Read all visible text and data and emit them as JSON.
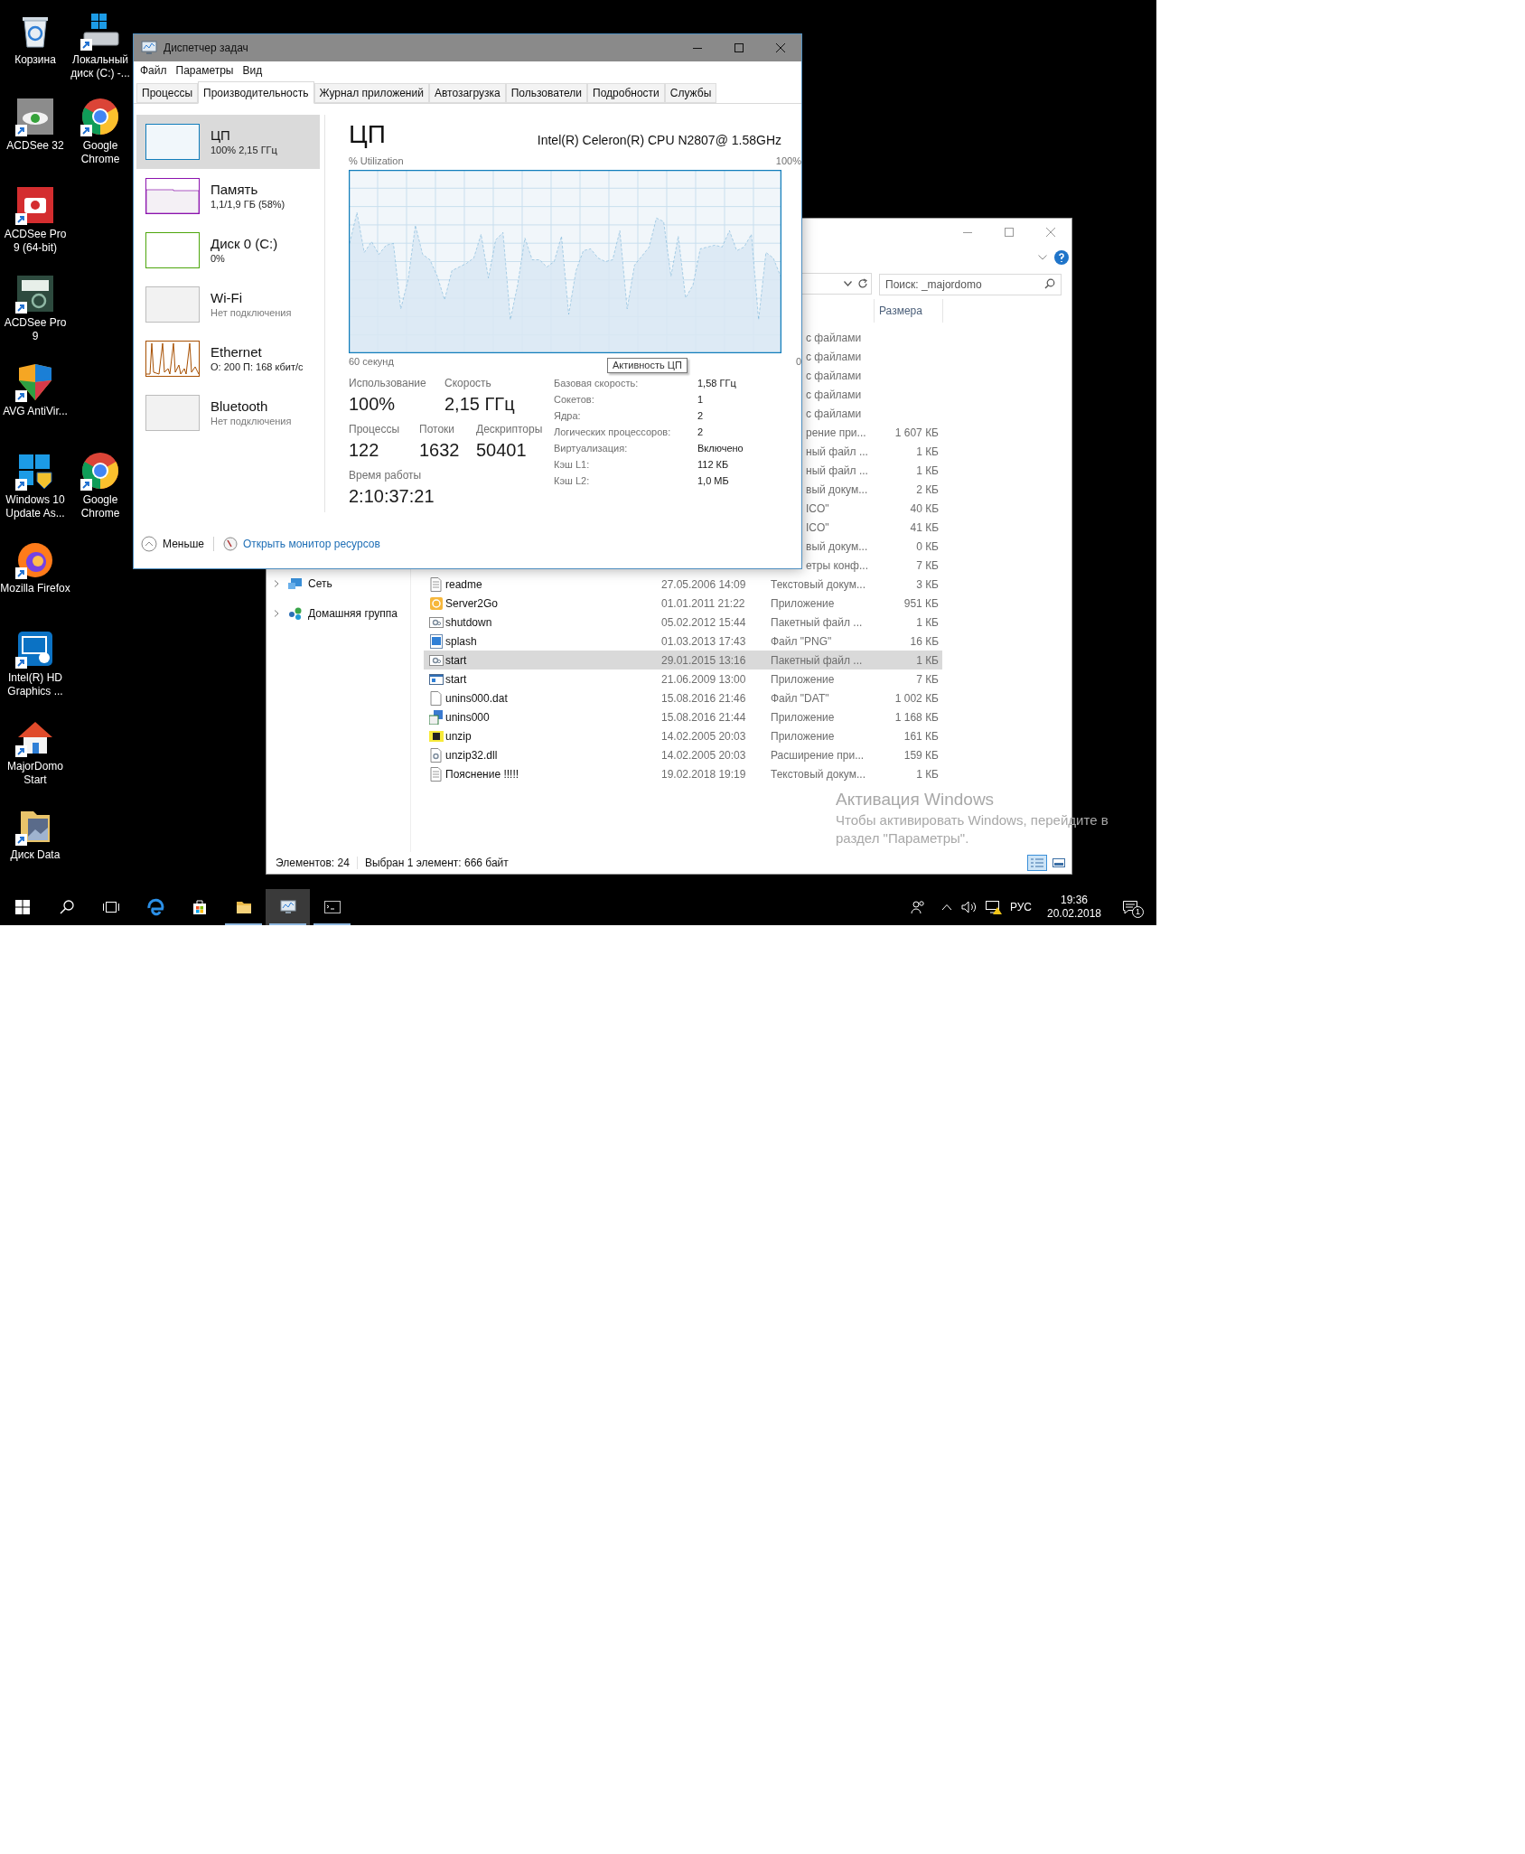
{
  "desktop": {
    "icons": [
      {
        "label": "Корзина"
      },
      {
        "label": "Локальный диск (C:) -..."
      },
      {
        "label": "ACDSee 32"
      },
      {
        "label": "Google Chrome"
      },
      {
        "label": "ACDSee Pro 9 (64-bit)"
      },
      {
        "label": "ACDSee Pro 9"
      },
      {
        "label": "AVG AntiVir..."
      },
      {
        "label": "Windows 10 Update As..."
      },
      {
        "label": "Google Chrome"
      },
      {
        "label": "Mozilla Firefox"
      },
      {
        "label": "Intel(R) HD Graphics ..."
      },
      {
        "label": "MajorDomo Start"
      },
      {
        "label": "Диск Data"
      }
    ]
  },
  "task_manager": {
    "title": "Диспетчер задач",
    "menu": [
      "Файл",
      "Параметры",
      "Вид"
    ],
    "tabs": [
      {
        "label": "Процессы",
        "selected": false
      },
      {
        "label": "Производительность",
        "selected": true
      },
      {
        "label": "Журнал приложений",
        "selected": false
      },
      {
        "label": "Автозагрузка",
        "selected": false
      },
      {
        "label": "Пользователи",
        "selected": false
      },
      {
        "label": "Подробности",
        "selected": false
      },
      {
        "label": "Службы",
        "selected": false
      }
    ],
    "sidebar": [
      {
        "title": "ЦП",
        "subtitle": "100% 2,15 ГГц",
        "kind": "blank",
        "color": "#117dbb",
        "dimmed": false,
        "selected": true
      },
      {
        "title": "Память",
        "subtitle": "1,1/1,9 ГБ (58%)",
        "kind": "fill",
        "color": "#8b12ae",
        "dimmed": false,
        "selected": false
      },
      {
        "title": "Диск 0 (C:)",
        "subtitle": "0%",
        "kind": "blank",
        "color": "#4da60c",
        "dimmed": false,
        "selected": false
      },
      {
        "title": "Wi-Fi",
        "subtitle": "Нет подключения",
        "kind": "blank",
        "color": "#bcbcbc",
        "dimmed": true,
        "selected": false
      },
      {
        "title": "Ethernet",
        "subtitle": "О: 200 П: 168 кбит/с",
        "kind": "spikes",
        "color": "#a74f01",
        "dimmed": false,
        "selected": false
      },
      {
        "title": "Bluetooth",
        "subtitle": "Нет подключения",
        "kind": "blank",
        "color": "#bcbcbc",
        "dimmed": true,
        "selected": false
      }
    ],
    "panel": {
      "title": "ЦП",
      "cpu_name": "Intel(R) Celeron(R) CPU N2807@ 1.58GHz",
      "graph": {
        "label": "% Utilization",
        "max_label": "100%",
        "span_label": "60 секунд",
        "end_label": "0"
      },
      "tooltip": "Активность ЦП",
      "stats": [
        {
          "label": "Использование",
          "value": "100%"
        },
        {
          "label": "Скорость",
          "value": "2,15 ГГц"
        },
        {
          "label": "Процессы",
          "value": "122"
        },
        {
          "label": "Потоки",
          "value": "1632"
        },
        {
          "label": "Дескрипторы",
          "value": "50401"
        },
        {
          "label": "Время работы",
          "value": "2:10:37:21"
        }
      ],
      "details": [
        {
          "label": "Базовая скорость:",
          "value": "1,58 ГГц"
        },
        {
          "label": "Сокетов:",
          "value": "1"
        },
        {
          "label": "Ядра:",
          "value": "2"
        },
        {
          "label": "Логических процессоров:",
          "value": "2"
        },
        {
          "label": "Виртуализация:",
          "value": "Включено"
        },
        {
          "label": "Кэш L1:",
          "value": "112 КБ"
        },
        {
          "label": "Кэш L2:",
          "value": "1,0 МБ"
        }
      ]
    },
    "footer": {
      "less": "Меньше",
      "link": "Открыть монитор ресурсов"
    }
  },
  "explorer": {
    "search_placeholder": "Поиск: _majordomo",
    "size_column": "Размера",
    "nav": [
      {
        "label": "Сеть",
        "expanded": false
      },
      {
        "label": "Домашняя группа",
        "expanded": false
      }
    ],
    "rows": [
      {
        "type": "с файлами",
        "selected": false
      },
      {
        "type": "с файлами",
        "selected": false
      },
      {
        "type": "с файлами",
        "selected": false
      },
      {
        "type": "с файлами",
        "selected": false
      },
      {
        "type": "с файлами",
        "selected": false
      },
      {
        "type": "рение при...",
        "size": "1 607 КБ",
        "selected": false
      },
      {
        "type": "ный файл ...",
        "size": "1 КБ",
        "selected": false
      },
      {
        "type": "ный файл ...",
        "size": "1 КБ",
        "selected": false
      },
      {
        "type": "вый докум...",
        "size": "2 КБ",
        "selected": false
      },
      {
        "type": "ICO\"",
        "size": "40 КБ",
        "selected": false
      },
      {
        "type": "ICO\"",
        "size": "41 КБ",
        "selected": false
      },
      {
        "type": "вый докум...",
        "size": "0 КБ",
        "selected": false
      },
      {
        "type": "етры конф...",
        "size": "7 КБ",
        "selected": false
      },
      {
        "name": "readme",
        "date": "27.05.2006 14:09",
        "type": "Текстовый докум...",
        "size": "3 КБ",
        "selected": false
      },
      {
        "name": "Server2Go",
        "date": "01.01.2011 21:22",
        "type": "Приложение",
        "size": "951 КБ",
        "selected": false
      },
      {
        "name": "shutdown",
        "date": "05.02.2012 15:44",
        "type": "Пакетный файл ...",
        "size": "1 КБ",
        "selected": false
      },
      {
        "name": "splash",
        "date": "01.03.2013 17:43",
        "type": "Файл \"PNG\"",
        "size": "16 КБ",
        "selected": false
      },
      {
        "name": "start",
        "date": "29.01.2015 13:16",
        "type": "Пакетный файл ...",
        "size": "1 КБ",
        "selected": true
      },
      {
        "name": "start",
        "date": "21.06.2009 13:00",
        "type": "Приложение",
        "size": "7 КБ",
        "selected": false
      },
      {
        "name": "unins000.dat",
        "date": "15.08.2016 21:46",
        "type": "Файл \"DAT\"",
        "size": "1 002 КБ",
        "selected": false
      },
      {
        "name": "unins000",
        "date": "15.08.2016 21:44",
        "type": "Приложение",
        "size": "1 168 КБ",
        "selected": false
      },
      {
        "name": "unzip",
        "date": "14.02.2005 20:03",
        "type": "Приложение",
        "size": "161 КБ",
        "selected": false
      },
      {
        "name": "unzip32.dll",
        "date": "14.02.2005 20:03",
        "type": "Расширение при...",
        "size": "159 КБ",
        "selected": false
      },
      {
        "name": "Пояснение !!!!!",
        "date": "19.02.2018 19:19",
        "type": "Текстовый докум...",
        "size": "1 КБ",
        "selected": false
      }
    ],
    "status": [
      "Элементов: 24",
      "Выбран 1 элемент: 666 байт"
    ],
    "views": [
      {
        "selected": true
      },
      {
        "selected": false
      }
    ]
  },
  "activation": {
    "title": "Активация Windows",
    "text": "Чтобы активировать Windows, перейдите в раздел \"Параметры\"."
  },
  "taskbar": {
    "apps": [
      {
        "running": false,
        "selected": false
      },
      {
        "running": false,
        "selected": false
      },
      {
        "running": true,
        "selected": false
      },
      {
        "running": true,
        "selected": true
      },
      {
        "running": true,
        "selected": false
      }
    ],
    "language": "РУС",
    "time": "19:36",
    "date": "20.02.2018",
    "notifications": "1"
  }
}
